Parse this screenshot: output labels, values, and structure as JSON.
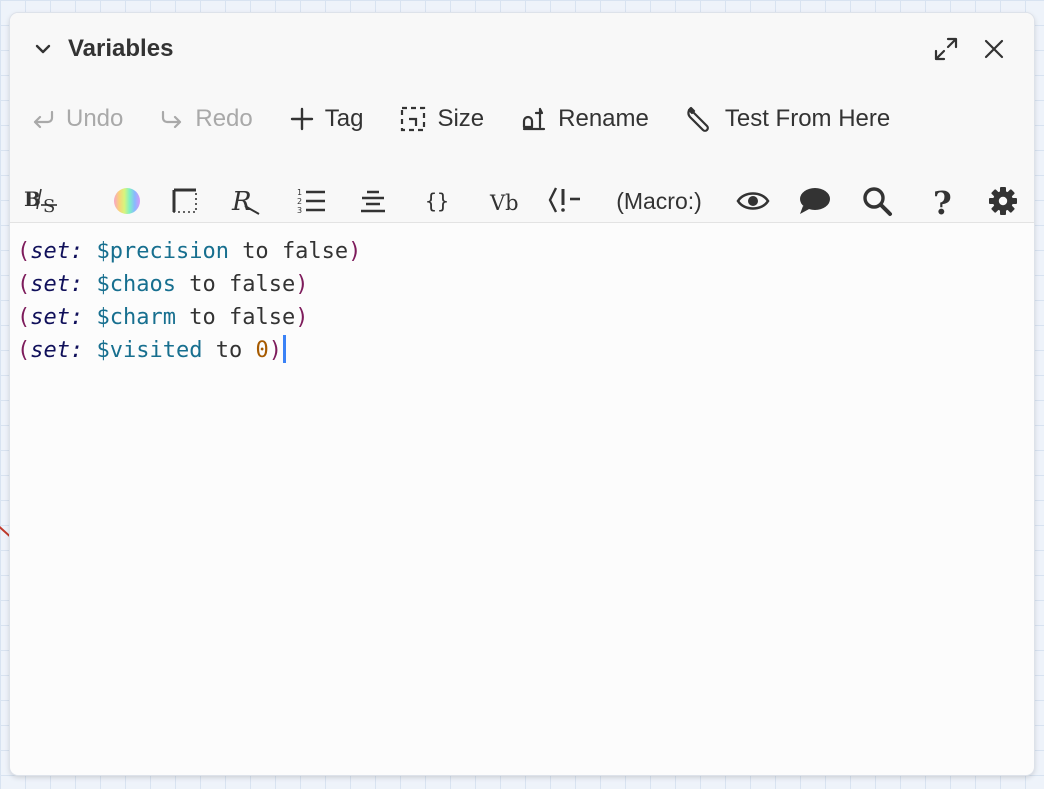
{
  "dialog": {
    "title": "Variables",
    "collapse_icon": "chevron-down-icon",
    "maximize_icon": "maximize-icon",
    "close_icon": "close-icon"
  },
  "toolbar_primary": {
    "undo": {
      "label": "Undo",
      "icon": "undo-icon",
      "enabled": false
    },
    "redo": {
      "label": "Redo",
      "icon": "redo-icon",
      "enabled": false
    },
    "tag": {
      "label": "Tag",
      "icon": "plus-icon"
    },
    "size": {
      "label": "Size",
      "icon": "size-icon"
    },
    "rename": {
      "label": "Rename",
      "icon": "rename-icon"
    },
    "test": {
      "label": "Test From Here",
      "icon": "wrench-icon"
    }
  },
  "toolbar_format": {
    "bold_strike": {
      "label": "B/S",
      "icon": "bold-strikethrough-icon"
    },
    "colour": {
      "icon": "color-wheel-icon"
    },
    "border": {
      "icon": "border-icon"
    },
    "special_char": {
      "label": "R",
      "icon": "special-character-icon"
    },
    "list": {
      "icon": "numbered-list-icon"
    },
    "align": {
      "icon": "align-center-icon"
    },
    "braces": {
      "label": "{ }",
      "icon": "braces-icon"
    },
    "verbatim": {
      "label": "Vb",
      "icon": "verbatim-icon"
    },
    "comment": {
      "label": "<!-",
      "icon": "html-comment-icon"
    },
    "macro": {
      "label": "(Macro:)"
    },
    "preview": {
      "icon": "eye-icon"
    },
    "comments": {
      "icon": "speech-bubble-icon"
    },
    "find": {
      "icon": "search-icon"
    },
    "help": {
      "label": "?",
      "icon": "help-icon"
    },
    "settings": {
      "icon": "gear-icon"
    }
  },
  "code_lines": [
    {
      "open": "(",
      "macro": "set:",
      "variable": "$precision",
      "keyword_to": "to",
      "value": "false",
      "value_type": "bool",
      "close": ")"
    },
    {
      "open": "(",
      "macro": "set:",
      "variable": "$chaos",
      "keyword_to": "to",
      "value": "false",
      "value_type": "bool",
      "close": ")"
    },
    {
      "open": "(",
      "macro": "set:",
      "variable": "$charm",
      "keyword_to": "to",
      "value": "false",
      "value_type": "bool",
      "close": ")"
    },
    {
      "open": "(",
      "macro": "set:",
      "variable": "$visited",
      "keyword_to": "to",
      "value": "0",
      "value_type": "number",
      "close": ")"
    }
  ],
  "colors": {
    "paren": "#7d1b5b",
    "macro": "#10105a",
    "variable": "#176f8f",
    "number": "#a65a00",
    "caret": "#3b82f6"
  }
}
